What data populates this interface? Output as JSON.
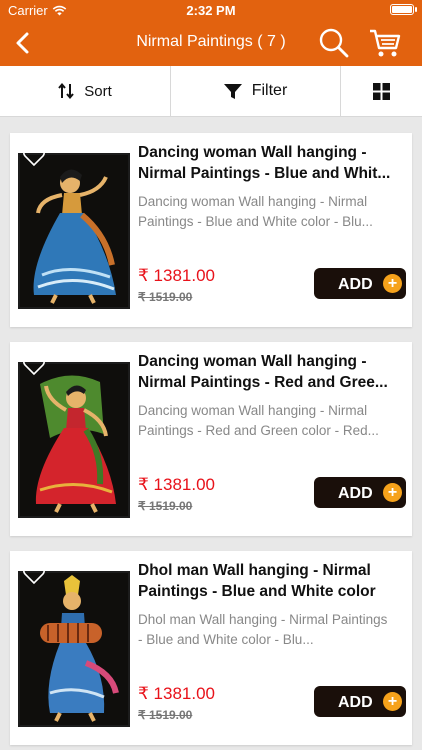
{
  "status_bar": {
    "carrier": "Carrier",
    "time": "2:32 PM"
  },
  "nav": {
    "title": "Nirmal Paintings ( 7 )"
  },
  "toolbar": {
    "sort_label": "Sort",
    "filter_label": "Filter"
  },
  "colors": {
    "brand": "#e2620f",
    "price": "#e8121a",
    "add_button": "#1a0f0a",
    "add_plus": "#f6a21b"
  },
  "products": [
    {
      "name": "Dancing woman Wall hanging - Nirmal Paintings - Blue and Whit...",
      "description": "Dancing woman Wall hanging - Nirmal Paintings - Blue and White color - Blu...",
      "price": "₹ 1381.00",
      "mrp": "₹ 1519.00",
      "add_label": "ADD"
    },
    {
      "name": "Dancing woman Wall hanging - Nirmal Paintings - Red and Gree...",
      "description": "Dancing woman Wall hanging - Nirmal Paintings - Red and Green color - Red...",
      "price": "₹ 1381.00",
      "mrp": "₹ 1519.00",
      "add_label": "ADD"
    },
    {
      "name": "Dhol man Wall hanging - Nirmal Paintings - Blue and White color",
      "description": "Dhol man Wall hanging - Nirmal Paintings - Blue and White color - Blu...",
      "price": "₹ 1381.00",
      "mrp": "₹ 1519.00",
      "add_label": "ADD"
    }
  ]
}
